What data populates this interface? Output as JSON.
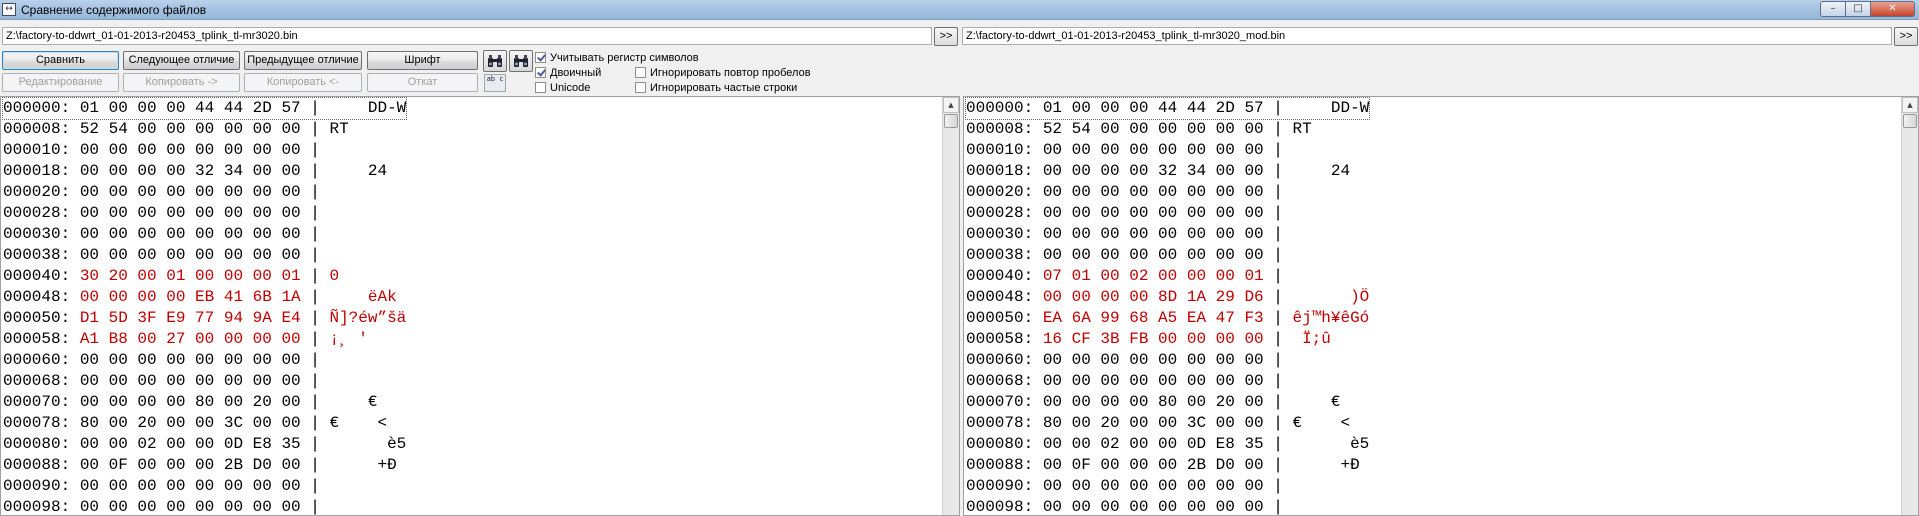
{
  "window": {
    "title": "Сравнение содержимого файлов",
    "icon_text": "↔",
    "buttons": {
      "minimize": "–",
      "maximize": "□",
      "close": "✕"
    }
  },
  "left_path": "Z:\\factory-to-ddwrt_01-01-2013-r20453_tplink_tl-mr3020.bin",
  "right_path": "Z:\\factory-to-ddwrt_01-01-2013-r20453_tplink_tl-mr3020_mod.bin",
  "browse_label": ">>",
  "toolbar": {
    "compare": "Сравнить",
    "next_diff": "Следующее отличие",
    "prev_diff": "Предыдущее отличие",
    "font": "Шрифт",
    "edit": "Редактирование",
    "copy_right": "Копировать ->",
    "copy_left": "Копировать <-",
    "rollback": "Откат",
    "find_icon": "binoculars-icon",
    "find_next_icon": "binoculars-icon",
    "font_icon_text": "ab c"
  },
  "options": {
    "match_case": {
      "label": "Учитывать регистр символов",
      "checked": true
    },
    "binary": {
      "label": "Двоичный",
      "checked": true
    },
    "unicode": {
      "label": "Unicode",
      "checked": false
    },
    "ignore_space_repeat": {
      "label": "Игнорировать повтор пробелов",
      "checked": false
    },
    "ignore_frequent": {
      "label": "Игнорировать частые строки",
      "checked": false
    }
  },
  "left_pane": {
    "lines": [
      {
        "offset": "000000:",
        "hex": "01 00 00 00 44 44 2D 57",
        "text": "    DD-W",
        "diff": false
      },
      {
        "offset": "000008:",
        "hex": "52 54 00 00 00 00 00 00",
        "text": "RT",
        "diff": false
      },
      {
        "offset": "000010:",
        "hex": "00 00 00 00 00 00 00 00",
        "text": "",
        "diff": false
      },
      {
        "offset": "000018:",
        "hex": "00 00 00 00 32 34 00 00",
        "text": "    24",
        "diff": false
      },
      {
        "offset": "000020:",
        "hex": "00 00 00 00 00 00 00 00",
        "text": "",
        "diff": false
      },
      {
        "offset": "000028:",
        "hex": "00 00 00 00 00 00 00 00",
        "text": "",
        "diff": false
      },
      {
        "offset": "000030:",
        "hex": "00 00 00 00 00 00 00 00",
        "text": "",
        "diff": false
      },
      {
        "offset": "000038:",
        "hex": "00 00 00 00 00 00 00 00",
        "text": "",
        "diff": false
      },
      {
        "offset": "000040:",
        "hex": "30 20 00 01 00 00 00 01",
        "text": "0",
        "diff": true
      },
      {
        "offset": "000048:",
        "hex": "00 00 00 00 EB 41 6B 1A",
        "text": "    ëAk",
        "diff": true
      },
      {
        "offset": "000050:",
        "hex": "D1 5D 3F E9 77 94 9A E4",
        "text": "Ñ]?éw”šä",
        "diff": true
      },
      {
        "offset": "000058:",
        "hex": "A1 B8 00 27 00 00 00 00",
        "text": "¡¸ '",
        "diff": true
      },
      {
        "offset": "000060:",
        "hex": "00 00 00 00 00 00 00 00",
        "text": "",
        "diff": false
      },
      {
        "offset": "000068:",
        "hex": "00 00 00 00 00 00 00 00",
        "text": "",
        "diff": false
      },
      {
        "offset": "000070:",
        "hex": "00 00 00 00 80 00 20 00",
        "text": "    €",
        "diff": false
      },
      {
        "offset": "000078:",
        "hex": "80 00 20 00 00 3C 00 00",
        "text": "€    <",
        "diff": false
      },
      {
        "offset": "000080:",
        "hex": "00 00 02 00 00 0D E8 35",
        "text": "      è5",
        "diff": false
      },
      {
        "offset": "000088:",
        "hex": "00 0F 00 00 00 2B D0 00",
        "text": "     +Đ",
        "diff": false
      },
      {
        "offset": "000090:",
        "hex": "00 00 00 00 00 00 00 00",
        "text": "",
        "diff": false
      },
      {
        "offset": "000098:",
        "hex": "00 00 00 00 00 00 00 00",
        "text": "",
        "diff": false
      }
    ]
  },
  "right_pane": {
    "lines": [
      {
        "offset": "000000:",
        "hex": "01 00 00 00 44 44 2D 57",
        "text": "    DD-W",
        "diff": false
      },
      {
        "offset": "000008:",
        "hex": "52 54 00 00 00 00 00 00",
        "text": "RT",
        "diff": false
      },
      {
        "offset": "000010:",
        "hex": "00 00 00 00 00 00 00 00",
        "text": "",
        "diff": false
      },
      {
        "offset": "000018:",
        "hex": "00 00 00 00 32 34 00 00",
        "text": "    24",
        "diff": false
      },
      {
        "offset": "000020:",
        "hex": "00 00 00 00 00 00 00 00",
        "text": "",
        "diff": false
      },
      {
        "offset": "000028:",
        "hex": "00 00 00 00 00 00 00 00",
        "text": "",
        "diff": false
      },
      {
        "offset": "000030:",
        "hex": "00 00 00 00 00 00 00 00",
        "text": "",
        "diff": false
      },
      {
        "offset": "000038:",
        "hex": "00 00 00 00 00 00 00 00",
        "text": "",
        "diff": false
      },
      {
        "offset": "000040:",
        "hex": "07 01 00 02 00 00 00 01",
        "text": "",
        "diff": true
      },
      {
        "offset": "000048:",
        "hex": "00 00 00 00 8D 1A 29 D6",
        "text": "      )Ö",
        "diff": true
      },
      {
        "offset": "000050:",
        "hex": "EA 6A 99 68 A5 EA 47 F3",
        "text": "êj™h¥êGó",
        "diff": true
      },
      {
        "offset": "000058:",
        "hex": "16 CF 3B FB 00 00 00 00",
        "text": " Ï;û",
        "diff": true
      },
      {
        "offset": "000060:",
        "hex": "00 00 00 00 00 00 00 00",
        "text": "",
        "diff": false
      },
      {
        "offset": "000068:",
        "hex": "00 00 00 00 00 00 00 00",
        "text": "",
        "diff": false
      },
      {
        "offset": "000070:",
        "hex": "00 00 00 00 80 00 20 00",
        "text": "    €",
        "diff": false
      },
      {
        "offset": "000078:",
        "hex": "80 00 20 00 00 3C 00 00",
        "text": "€    <",
        "diff": false
      },
      {
        "offset": "000080:",
        "hex": "00 00 02 00 00 0D E8 35",
        "text": "      è5",
        "diff": false
      },
      {
        "offset": "000088:",
        "hex": "00 0F 00 00 00 2B D0 00",
        "text": "     +Đ",
        "diff": false
      },
      {
        "offset": "000090:",
        "hex": "00 00 00 00 00 00 00 00",
        "text": "",
        "diff": false
      },
      {
        "offset": "000098:",
        "hex": "00 00 00 00 00 00 00 00",
        "text": "",
        "diff": false
      }
    ]
  },
  "colors": {
    "diff": "#c00000",
    "title_bar": "#a7c3e2"
  }
}
